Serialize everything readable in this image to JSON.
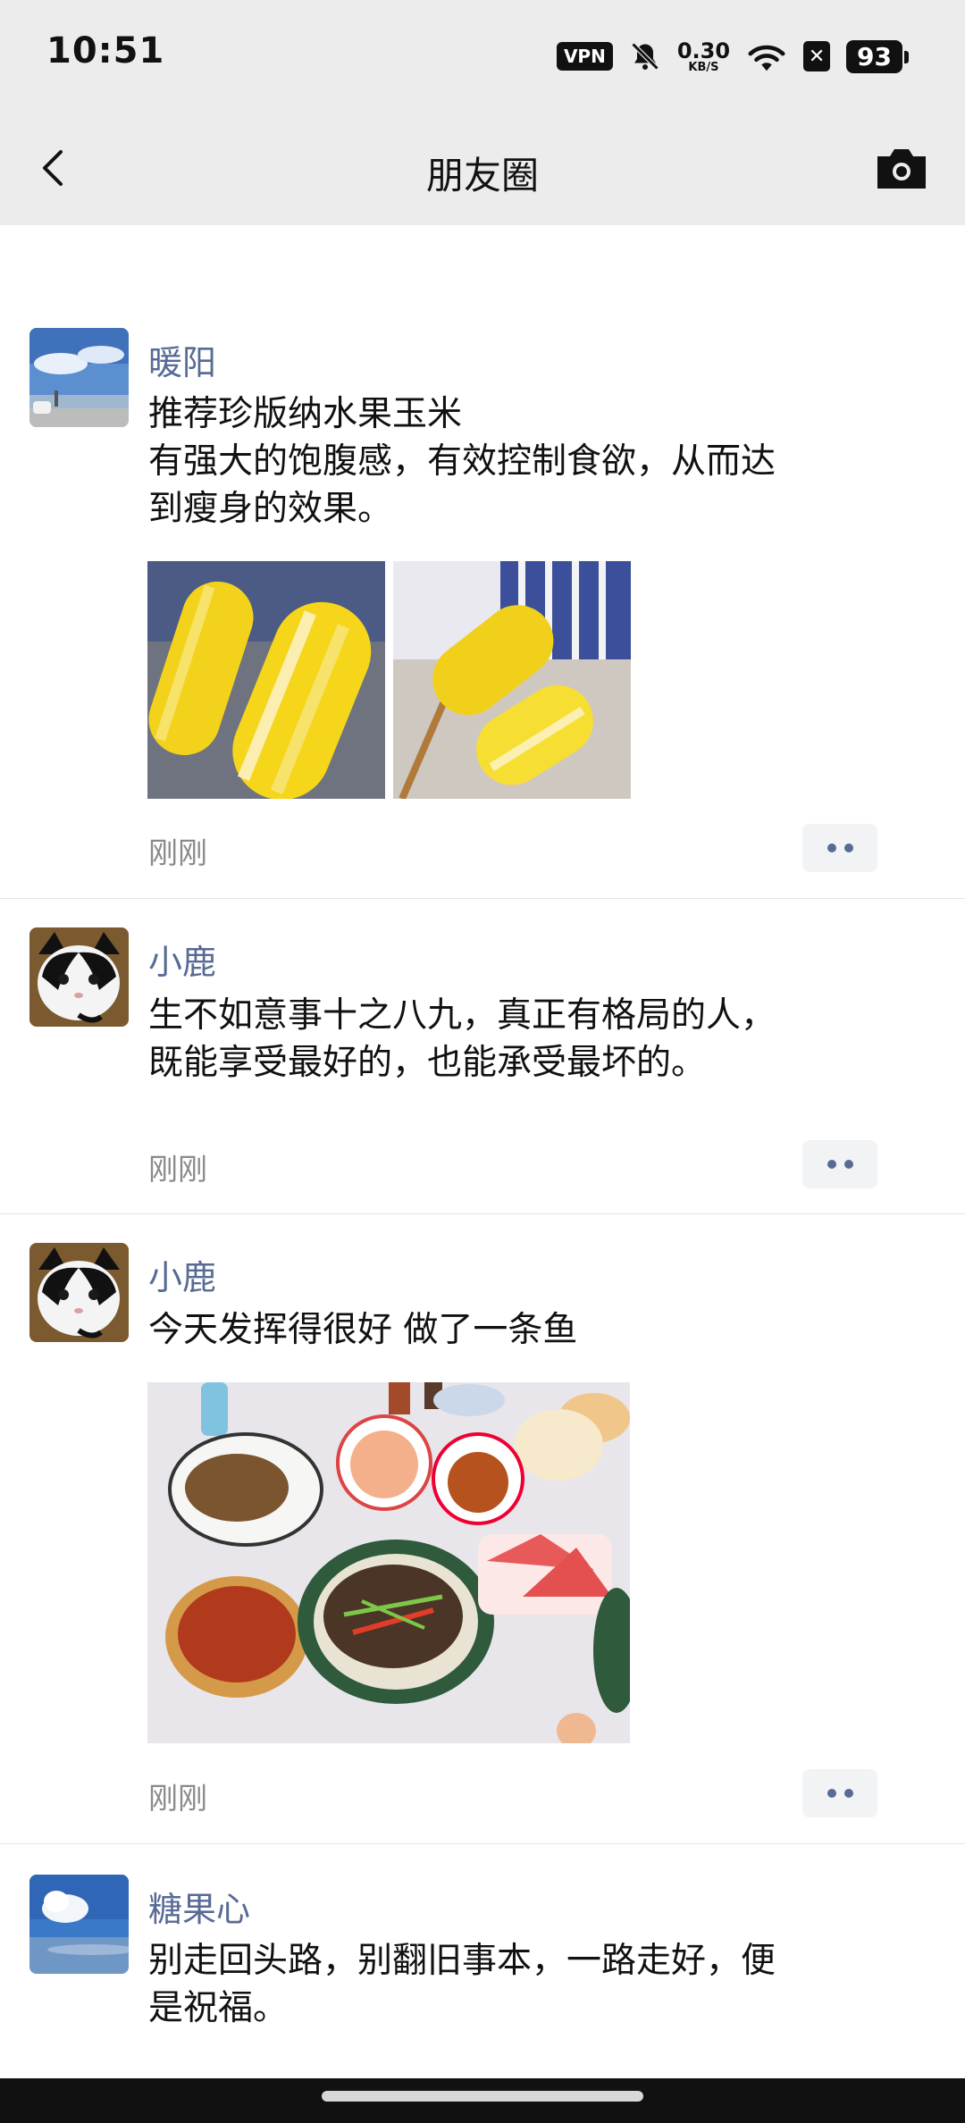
{
  "status_bar": {
    "time": "10:51",
    "vpn": "VPN",
    "net_speed": "0.30",
    "net_unit": "KB/S",
    "battery": "93"
  },
  "nav": {
    "title": "朋友圈"
  },
  "posts": [
    {
      "name": "暖阳",
      "text_lines": [
        "推荐珍版纳水果玉米",
        "有强大的饱腹感，有效控制食欲，从而达",
        "到瘦身的效果。"
      ],
      "time": "刚刚"
    },
    {
      "name": "小鹿",
      "text_lines": [
        "生不如意事十之八九，真正有格局的人，",
        "既能享受最好的，也能承受最坏的。"
      ],
      "time": "刚刚"
    },
    {
      "name": "小鹿",
      "text_lines": [
        "今天发挥得很好 做了一条鱼"
      ],
      "time": "刚刚"
    },
    {
      "name": "糖果心",
      "text_lines": [
        "别走回头路，别翻旧事本，一路走好，便",
        "是祝福。"
      ]
    }
  ],
  "colors": {
    "name_blue": "#576b95",
    "header_bg": "#ececec"
  }
}
